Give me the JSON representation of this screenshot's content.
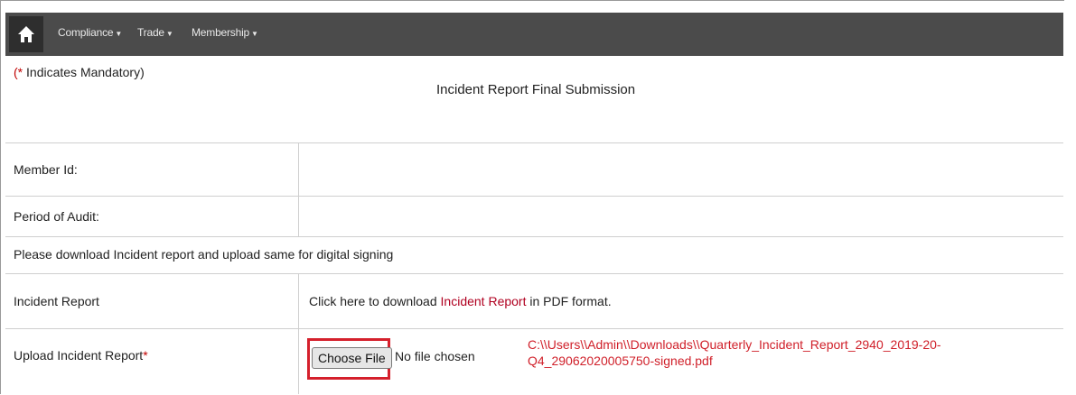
{
  "nav": {
    "items": [
      {
        "label": "Compliance"
      },
      {
        "label": "Trade"
      },
      {
        "label": "Membership"
      }
    ]
  },
  "header": {
    "mandatory_note": "Indicates Mandatory)",
    "mandatory_prefix": "(*",
    "title": "Incident Report Final Submission"
  },
  "form": {
    "member_id_label": "Member Id:",
    "member_id_value": "",
    "period_label": "Period of Audit:",
    "period_value": "",
    "instruction": "Please download Incident report and upload same for digital signing",
    "report_label": "Incident Report",
    "report_text_before": "Click here to download",
    "report_link": "Incident Report",
    "report_text_after": "in PDF format.",
    "upload_label": "Upload Incident Report",
    "upload_required_mark": "*",
    "choose_file_button": "Choose File",
    "no_file_text": "No file chosen",
    "file_path": "C:\\\\Users\\\\Admin\\\\Downloads\\\\Quarterly_Incident_Report_2940_2019-20-Q4_29062020005750-signed.pdf"
  },
  "colors": {
    "navbar": "#4b4b4b",
    "link": "#b00020",
    "required": "#c00000",
    "highlight_box": "#d5202c"
  }
}
